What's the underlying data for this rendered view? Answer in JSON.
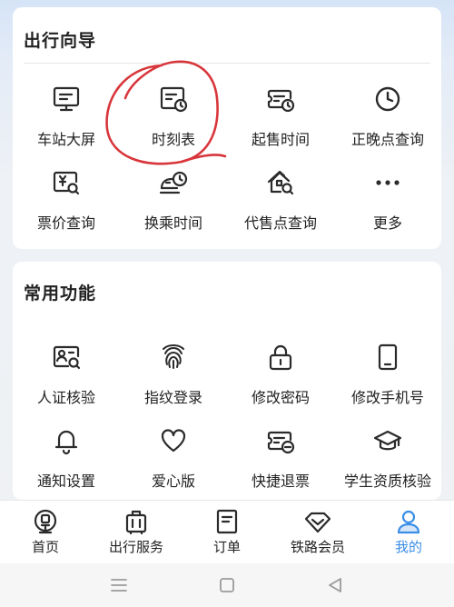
{
  "guide": {
    "title": "出行向导",
    "items": [
      {
        "label": "车站大屏",
        "icon": "station-screen-icon"
      },
      {
        "label": "时刻表",
        "icon": "timetable-icon"
      },
      {
        "label": "起售时间",
        "icon": "ticket-clock-icon"
      },
      {
        "label": "正晚点查询",
        "icon": "clock-icon"
      },
      {
        "label": "票价查询",
        "icon": "price-search-icon"
      },
      {
        "label": "换乘时间",
        "icon": "train-clock-icon"
      },
      {
        "label": "代售点查询",
        "icon": "house-search-icon"
      },
      {
        "label": "更多",
        "icon": "more-dots-icon"
      }
    ]
  },
  "common": {
    "title": "常用功能",
    "items": [
      {
        "label": "人证核验",
        "icon": "id-card-search-icon"
      },
      {
        "label": "指纹登录",
        "icon": "fingerprint-icon"
      },
      {
        "label": "修改密码",
        "icon": "lock-icon"
      },
      {
        "label": "修改手机号",
        "icon": "phone-icon"
      },
      {
        "label": "通知设置",
        "icon": "bell-icon"
      },
      {
        "label": "爱心版",
        "icon": "heart-icon"
      },
      {
        "label": "快捷退票",
        "icon": "ticket-refund-icon"
      },
      {
        "label": "学生资质核验",
        "icon": "graduation-cap-icon"
      }
    ]
  },
  "nav": {
    "items": [
      {
        "label": "首页",
        "icon": "home-train-icon"
      },
      {
        "label": "出行服务",
        "icon": "luggage-icon"
      },
      {
        "label": "订单",
        "icon": "order-document-icon"
      },
      {
        "label": "铁路会员",
        "icon": "diamond-icon"
      },
      {
        "label": "我的",
        "icon": "user-icon"
      }
    ],
    "active": "我的"
  },
  "colors": {
    "accent": "#3a8ee6",
    "annotation": "#d8363b",
    "icon": "#2b2b2b"
  }
}
